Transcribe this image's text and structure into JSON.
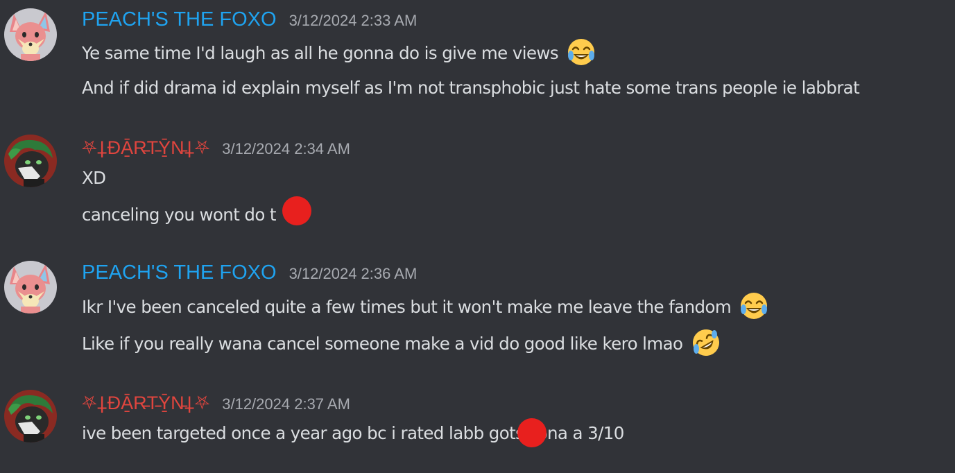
{
  "colors": {
    "background": "#313338",
    "peach_name": "#1fa3f0",
    "dartyn_name": "#e0453e",
    "timestamp": "#a7aab0",
    "text": "#dbdee1",
    "redaction": "#e8201e"
  },
  "messages": [
    {
      "author": "PEACH'S THE FOXO",
      "avatar_icon": "fox-avatar-icon",
      "timestamp": "3/12/2024 2:33 AM",
      "lines": [
        {
          "text": "Ye same time I'd laugh as all he gonna do is give me views",
          "emoji": "joy-emoji"
        },
        {
          "text": "And if did drama id explain myself as I'm not transphobic just hate some trans people ie labbrat"
        }
      ]
    },
    {
      "author": "⛧⸸ĐĀ̱R̵T̵Ȳ̱N̵⸸⛧",
      "avatar_icon": "wolf-avatar-icon",
      "timestamp": "3/12/2024 2:34 AM",
      "lines": [
        {
          "text": "XD"
        },
        {
          "text": "canceling you wont do  t",
          "redaction": "redaction-mark"
        }
      ]
    },
    {
      "author": "PEACH'S THE FOXO",
      "avatar_icon": "fox-avatar-icon",
      "timestamp": "3/12/2024 2:36 AM",
      "lines": [
        {
          "text": "Ikr I've been canceled quite a few times but it won't make me leave the fandom",
          "emoji": "joy-emoji"
        },
        {
          "text": "Like if you really wana cancel someone make a vid do good like kero lmao",
          "emoji": "rofl-emoji"
        }
      ]
    },
    {
      "author": "⛧⸸ĐĀ̱R̵T̵Ȳ̱N̵⸸⛧",
      "avatar_icon": "wolf-avatar-icon",
      "timestamp": "3/12/2024 2:37 AM",
      "lines": [
        {
          "text": "ive been targeted once a year ago bc i rated labb  gots sona a 3/10",
          "redaction": "redaction-mark"
        }
      ]
    }
  ]
}
